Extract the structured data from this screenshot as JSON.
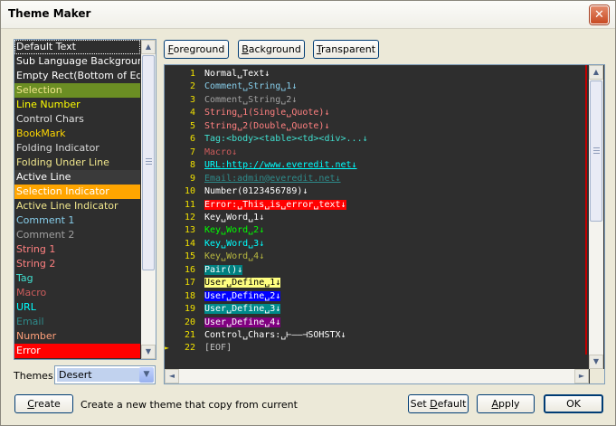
{
  "window": {
    "title": "Theme Maker",
    "close_symbol": "✕"
  },
  "items": [
    {
      "label": "Default Text",
      "fg": "#ffffff",
      "bg": "#2e2e2e",
      "selected": true
    },
    {
      "label": "Sub Language Background",
      "fg": "#ffffff",
      "bg": "#2e2e2e"
    },
    {
      "label": "Empty Rect(Bottom of Edit)",
      "fg": "#ffffff",
      "bg": "#2e2e2e"
    },
    {
      "label": "Selection",
      "fg": "#f0e68c",
      "bg": "#6b8e23"
    },
    {
      "label": "Line Number",
      "fg": "#ffff00",
      "bg": "#2e2e2e"
    },
    {
      "label": "Control Chars",
      "fg": "#e0e0e0",
      "bg": "#2e2e2e"
    },
    {
      "label": "BookMark",
      "fg": "#ffd700",
      "bg": "#2e2e2e"
    },
    {
      "label": "Folding Indicator",
      "fg": "#d8d8d8",
      "bg": "#2e2e2e"
    },
    {
      "label": "Folding Under Line",
      "fg": "#f0e68c",
      "bg": "#2e2e2e"
    },
    {
      "label": "Active Line",
      "fg": "#ffffff",
      "bg": "#3a3a3a"
    },
    {
      "label": "Selection Indicator",
      "fg": "#ffffff",
      "bg": "#ffa500"
    },
    {
      "label": "Active Line Indicator",
      "fg": "#f0e68c",
      "bg": "#2e2e2e"
    },
    {
      "label": "Comment 1",
      "fg": "#87ceeb",
      "bg": "#2e2e2e"
    },
    {
      "label": "Comment 2",
      "fg": "#a0a0a0",
      "bg": "#2e2e2e"
    },
    {
      "label": "String 1",
      "fg": "#ff8080",
      "bg": "#2e2e2e"
    },
    {
      "label": "String 2",
      "fg": "#ff8080",
      "bg": "#2e2e2e"
    },
    {
      "label": "Tag",
      "fg": "#40e0d0",
      "bg": "#2e2e2e"
    },
    {
      "label": "Macro",
      "fg": "#cd5c5c",
      "bg": "#2e2e2e"
    },
    {
      "label": "URL",
      "fg": "#00ffff",
      "bg": "#2e2e2e"
    },
    {
      "label": "Email",
      "fg": "#2e8b8b",
      "bg": "#2e2e2e"
    },
    {
      "label": "Number",
      "fg": "#ffa07a",
      "bg": "#2e2e2e"
    },
    {
      "label": "Error",
      "fg": "#ffffff",
      "bg": "#ff0000"
    }
  ],
  "buttons": {
    "foreground": {
      "u": "F",
      "rest": "oreground"
    },
    "background": {
      "u": "B",
      "rest": "ackground"
    },
    "transparent": {
      "u": "T",
      "rest": "ransparent"
    },
    "create": {
      "u": "C",
      "rest": "reate"
    },
    "set_default": {
      "pre": "Set ",
      "u": "D",
      "rest": "efault"
    },
    "apply": {
      "u": "A",
      "rest": "pply"
    },
    "ok": "OK"
  },
  "themes": {
    "label": "Themes:",
    "value": "Desert"
  },
  "status": "Create a new theme that copy from current",
  "scroll_glyphs": {
    "up": "▲",
    "down": "▼",
    "left": "◄",
    "right": "►",
    "combo": "▼"
  },
  "code_lines": [
    {
      "num": "1",
      "text": "Normal␣Text↓",
      "fg": "#ffffff",
      "bg": ""
    },
    {
      "num": "2",
      "text": "Comment␣String␣1↓",
      "fg": "#87ceeb",
      "bg": ""
    },
    {
      "num": "3",
      "text": "Comment␣String␣2↓",
      "fg": "#a0a0a0",
      "bg": ""
    },
    {
      "num": "4",
      "text": "String␣1(Single␣Quote)↓",
      "fg": "#ff8080",
      "bg": ""
    },
    {
      "num": "5",
      "text": "String␣2(Double␣Quote)↓",
      "fg": "#ff8080",
      "bg": ""
    },
    {
      "num": "6",
      "text": "Tag:<body><table><td><div>...↓",
      "fg": "#40e0d0",
      "bg": ""
    },
    {
      "num": "7",
      "text": "Macro↓",
      "fg": "#cd5c5c",
      "bg": ""
    },
    {
      "num": "8",
      "text": "URL:http://www.everedit.net↓",
      "fg": "#00ffff",
      "bg": "",
      "underline": true
    },
    {
      "num": "9",
      "text": "Email:admin@everedit.net↓",
      "fg": "#2e8b8b",
      "bg": "",
      "underline": true
    },
    {
      "num": "10",
      "text": "Number(0123456789)↓",
      "fg": "#ffffff",
      "bg": ""
    },
    {
      "num": "11",
      "text": "Error:␣This␣is␣error␣text↓",
      "fg": "#ffffff",
      "bg": "#ff0000"
    },
    {
      "num": "12",
      "text": "Key␣Word␣1↓",
      "fg": "#ffffff",
      "bg": ""
    },
    {
      "num": "13",
      "text": "Key␣Word␣2↓",
      "fg": "#00ff00",
      "bg": ""
    },
    {
      "num": "14",
      "text": "Key␣Word␣3↓",
      "fg": "#00ffff",
      "bg": ""
    },
    {
      "num": "15",
      "text": "Key␣Word␣4↓",
      "fg": "#b8b840",
      "bg": ""
    },
    {
      "num": "16",
      "text": "Pair()↓",
      "fg": "#ffffff",
      "bg": "#008080"
    },
    {
      "num": "17",
      "text": "User␣Define␣1↓",
      "fg": "#000000",
      "bg": "#ffff80"
    },
    {
      "num": "18",
      "text": "User␣Define␣2↓",
      "fg": "#ffffff",
      "bg": "#0000ff"
    },
    {
      "num": "19",
      "text": "User␣Define␣3↓",
      "fg": "#ffffff",
      "bg": "#008b8b"
    },
    {
      "num": "20",
      "text": "User␣Define␣4↓",
      "fg": "#ffffff",
      "bg": "#800080"
    },
    {
      "num": "21",
      "text": "Control␣Chars:␣⊢——⊣SOHSTX↓",
      "fg": "#ffffff",
      "bg": ""
    },
    {
      "num": "22",
      "text": "[EOF]",
      "fg": "#c0c0c0",
      "bg": "",
      "arrow": "►"
    }
  ]
}
